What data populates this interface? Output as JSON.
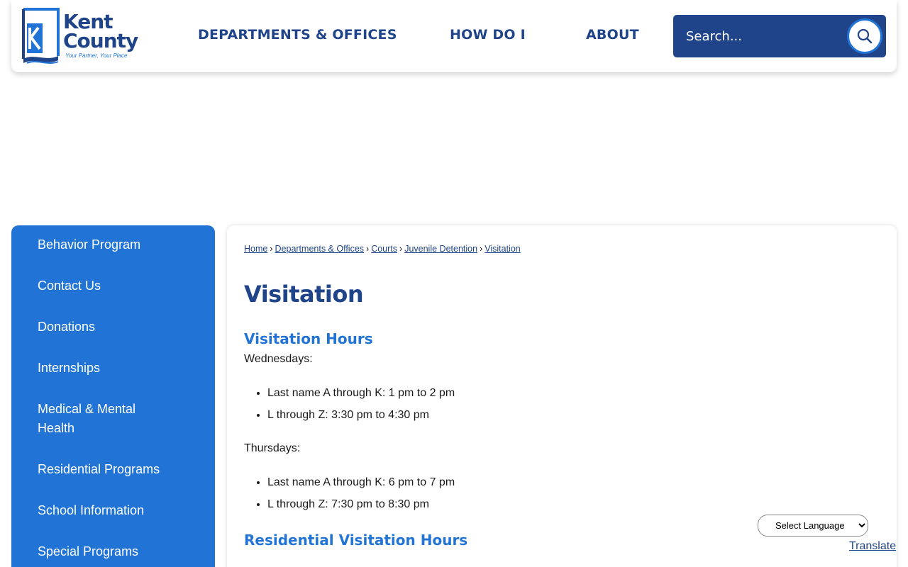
{
  "header": {
    "logo": {
      "line1": "Kent",
      "line2": "County",
      "tagline": "Your Partner, Your Place"
    },
    "nav": [
      {
        "label": "DEPARTMENTS & OFFICES"
      },
      {
        "label": "HOW DO I"
      },
      {
        "label": "ABOUT"
      }
    ],
    "search": {
      "placeholder": "Search..."
    }
  },
  "sidebar": {
    "items": [
      {
        "label": "Behavior Program"
      },
      {
        "label": "Contact Us"
      },
      {
        "label": "Donations"
      },
      {
        "label": "Internships"
      },
      {
        "label": "Medical & Mental Health"
      },
      {
        "label": "Residential Programs"
      },
      {
        "label": "School Information"
      },
      {
        "label": "Special Programs"
      }
    ]
  },
  "breadcrumb": [
    {
      "label": "Home"
    },
    {
      "label": "Departments & Offices"
    },
    {
      "label": "Courts"
    },
    {
      "label": "Juvenile Detention"
    },
    {
      "label": "Visitation"
    }
  ],
  "page": {
    "title": "Visitation",
    "sections": [
      {
        "heading": "Visitation Hours",
        "days": [
          {
            "label": "Wednesdays:",
            "items": [
              "Last name A through K: 1 pm to 2 pm",
              "L through Z: 3:30 pm to 4:30 pm"
            ]
          },
          {
            "label": "Thursdays:",
            "items": [
              "Last name A through K: 6 pm to 7 pm",
              "L through Z: 7:30 pm to 8:30 pm"
            ]
          }
        ]
      },
      {
        "heading": "Residential Visitation Hours"
      }
    ]
  },
  "translate": {
    "select_label": "Select Language",
    "link": "Translate"
  },
  "colors": {
    "navy": "#1f4489",
    "blue": "#2174d6"
  }
}
